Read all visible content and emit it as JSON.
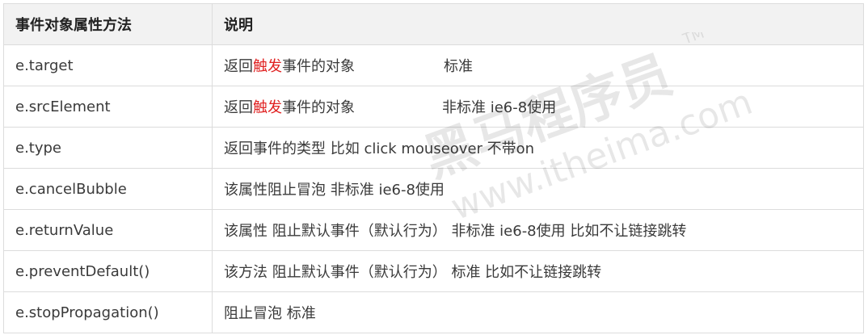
{
  "table": {
    "headers": [
      "事件对象属性方法",
      "说明"
    ],
    "rows": [
      {
        "prop": "e.target",
        "desc_pre": "返回",
        "desc_hl": "触发",
        "desc_post": "事件的对象",
        "desc_note": "标准"
      },
      {
        "prop": "e.srcElement",
        "desc_pre": "返回",
        "desc_hl": "触发",
        "desc_post": "事件的对象",
        "desc_note": "非标准  ie6-8使用"
      },
      {
        "prop": "e.type",
        "desc": "返回事件的类型  比如 click  mouseover  不带on"
      },
      {
        "prop": "e.cancelBubble",
        "desc": "该属性阻止冒泡 非标准  ie6-8使用"
      },
      {
        "prop": "e.returnValue",
        "desc": "该属性 阻止默认事件（默认行为） 非标准  ie6-8使用 比如不让链接跳转"
      },
      {
        "prop": "e.preventDefault()",
        "desc": "该方法 阻止默认事件（默认行为） 标准  比如不让链接跳转"
      },
      {
        "prop": "e.stopPropagation()",
        "desc": "阻止冒泡 标准"
      }
    ]
  },
  "watermark": {
    "text_cn": "黑马程序员",
    "text_url": "www.itheima.com",
    "text_tm": "TM",
    "color": "#000000"
  }
}
